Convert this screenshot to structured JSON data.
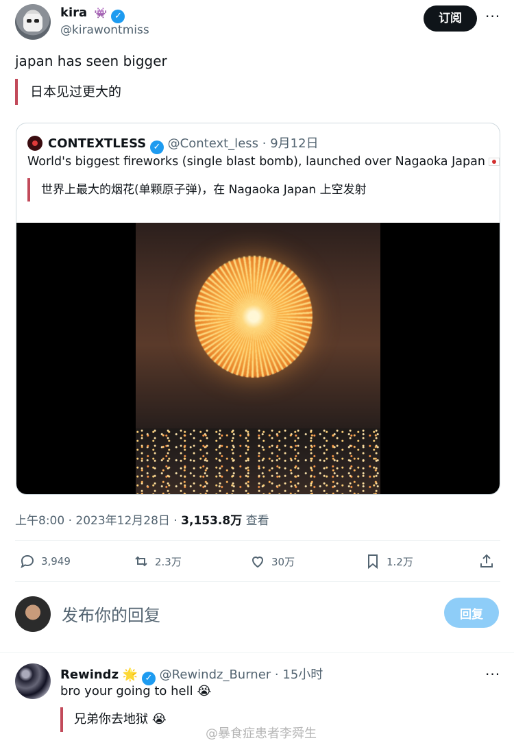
{
  "tweet": {
    "author_name": "kira",
    "author_badge": "👾",
    "author_handle": "@kirawontmiss",
    "subscribe_label": "订阅",
    "more_label": "···",
    "text": "japan has seen bigger",
    "translation": "日本见过更大的"
  },
  "quote": {
    "name": "CONTEXTLESS",
    "handle": "@Context_less",
    "date": "9月12日",
    "text": "World's biggest fireworks (single blast bomb), launched over Nagaoka Japan",
    "translation": "世界上最大的烟花(单颗原子弹)，在 Nagaoka Japan 上空发射"
  },
  "meta": {
    "time": "上午8:00",
    "date": "2023年12月28日",
    "views_count": "3,153.8万",
    "views_label": "查看"
  },
  "actions": {
    "replies": "3,949",
    "reposts": "2.3万",
    "likes": "30万",
    "bookmarks": "1.2万"
  },
  "compose": {
    "placeholder": "发布你的回复",
    "reply_label": "回复"
  },
  "reply": {
    "name": "Rewindz",
    "badge": "🌟",
    "handle": "@Rewindz_Burner",
    "time": "15小时",
    "text": "bro your going to hell 😭",
    "translation": "兄弟你去地狱 😭"
  },
  "watermark": "@暴食症患者李舜生",
  "colors": {
    "verified": "#1d9bf0",
    "accent_bar": "#c24a5a",
    "reply_button": "#8ecdf8"
  }
}
